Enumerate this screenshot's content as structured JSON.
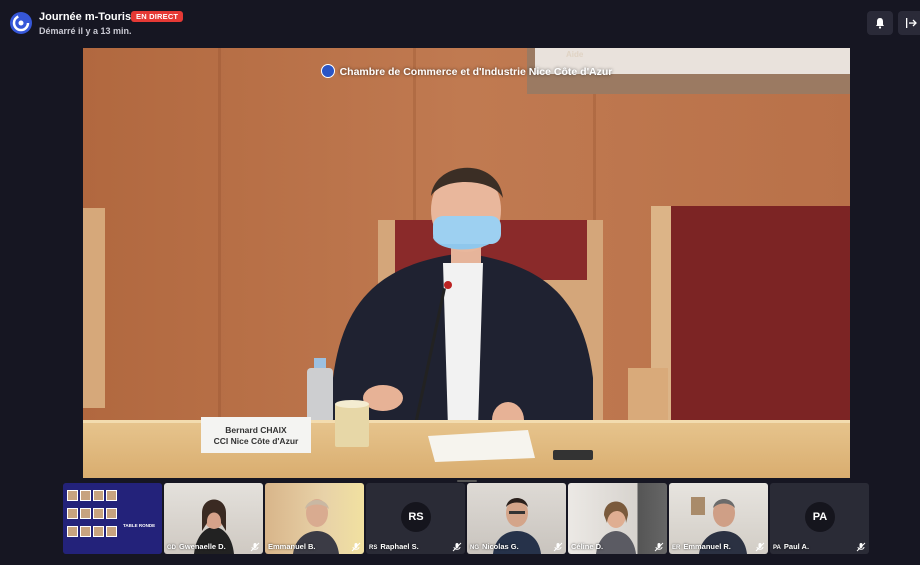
{
  "header": {
    "event_title": "Journée m-Tourisme",
    "live_badge": "EN DIRECT",
    "started": "Démarré il y a 13 min."
  },
  "stage": {
    "title": "Chambre de Commerce et d'Industrie Nice Côte d'Azur",
    "sign_text": "Aide",
    "nameplate": {
      "line1": "Bernard CHAIX",
      "line2": "CCI Nice Côte d'Azur"
    }
  },
  "thumbnails": [
    {
      "kind": "poster",
      "poster_text": "TABLE RONDE"
    },
    {
      "initials": "GD",
      "name": "Gwenaelle D.",
      "video": true
    },
    {
      "initials": "",
      "name": "Emmanuel B.",
      "video": true
    },
    {
      "initials": "RS",
      "name": "Raphael S.",
      "video": false
    },
    {
      "initials": "NG",
      "name": "Nicolas G.",
      "video": true
    },
    {
      "initials": "",
      "name": "Céline D.",
      "video": true
    },
    {
      "initials": "ER",
      "name": "Emmanuel R.",
      "video": true
    },
    {
      "initials": "PA",
      "name": "Paul A.",
      "video": false
    }
  ],
  "icons": {
    "logo": "brand-logo-icon",
    "bell": "bell-icon",
    "leave": "leave-icon",
    "mic_muted": "mic-muted-icon"
  },
  "colors": {
    "background": "#161622",
    "live": "#e53935",
    "brand": "#3657d8"
  }
}
